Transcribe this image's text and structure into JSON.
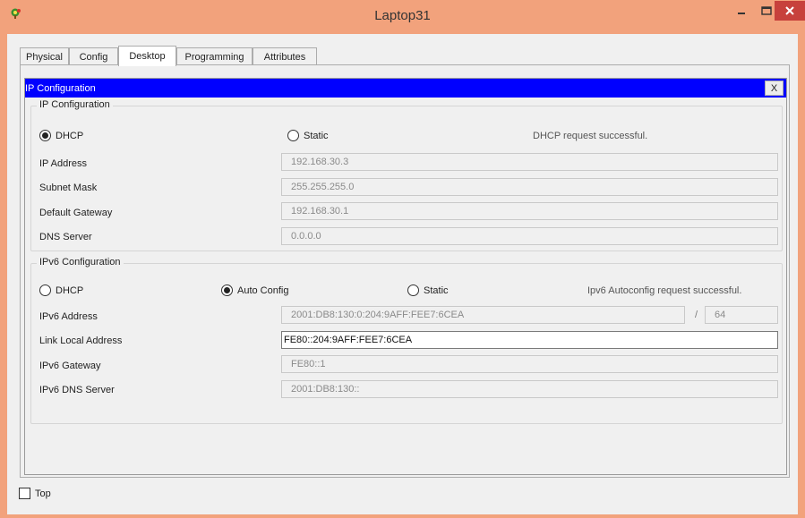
{
  "window": {
    "title": "Laptop31"
  },
  "tabs": [
    {
      "label": "Physical"
    },
    {
      "label": "Config"
    },
    {
      "label": "Desktop"
    },
    {
      "label": "Programming"
    },
    {
      "label": "Attributes"
    }
  ],
  "active_tab": "Desktop",
  "panel": {
    "header": "IP Configuration",
    "close_label": "X"
  },
  "ipv4": {
    "legend": "IP Configuration",
    "dhcp_label": "DHCP",
    "static_label": "Static",
    "mode": "DHCP",
    "status": "DHCP request successful.",
    "ip_address": {
      "label": "IP Address",
      "value": "192.168.30.3"
    },
    "subnet_mask": {
      "label": "Subnet Mask",
      "value": "255.255.255.0"
    },
    "default_gateway": {
      "label": "Default Gateway",
      "value": "192.168.30.1"
    },
    "dns_server": {
      "label": "DNS Server",
      "value": "0.0.0.0"
    }
  },
  "ipv6": {
    "legend": "IPv6 Configuration",
    "dhcp_label": "DHCP",
    "auto_label": "Auto Config",
    "static_label": "Static",
    "mode": "Auto Config",
    "status": "Ipv6 Autoconfig request successful.",
    "address": {
      "label": "IPv6 Address",
      "value": "2001:DB8:130:0:204:9AFF:FEE7:6CEA",
      "prefix_separator": "/",
      "prefix": "64"
    },
    "link_local": {
      "label": "Link Local Address",
      "value": "FE80::204:9AFF:FEE7:6CEA"
    },
    "gateway": {
      "label": "IPv6 Gateway",
      "value": "FE80::1"
    },
    "dns_server": {
      "label": "IPv6 DNS Server",
      "value": "2001:DB8:130::"
    }
  },
  "bottom": {
    "top_label": "Top",
    "top_checked": false
  },
  "colors": {
    "titlebar": "#f2a27c",
    "header_blue": "#0000ff",
    "close_red": "#c7413c"
  }
}
